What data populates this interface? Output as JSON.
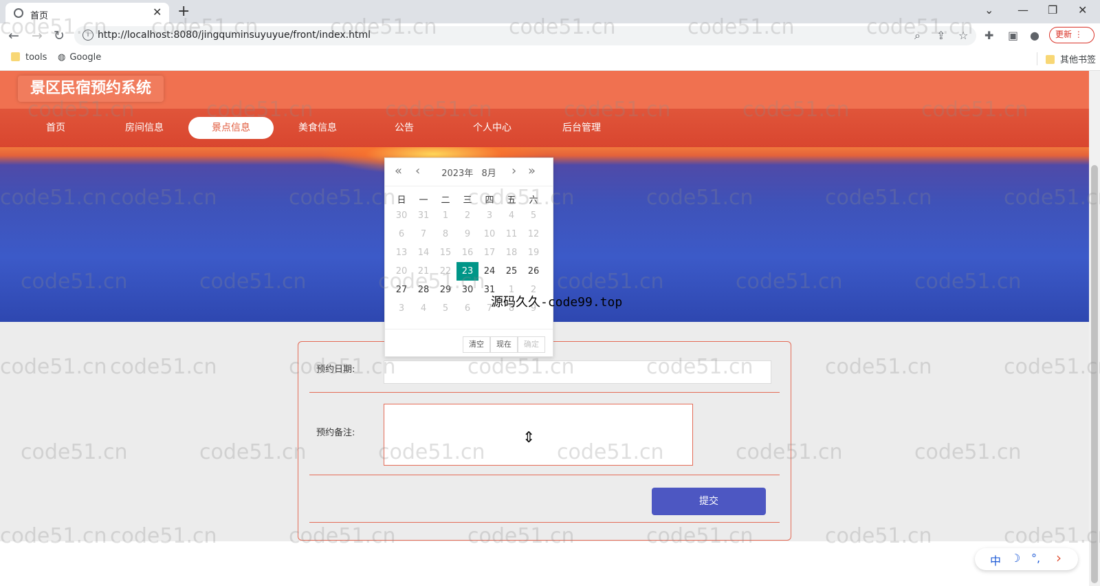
{
  "browser": {
    "tab_title": "首页",
    "url": "http://localhost:8080/jingquminsuyuyue/front/index.html",
    "update_label": "更新",
    "bookmarks": [
      "tools",
      "Google"
    ],
    "other_bookmarks": "其他书签"
  },
  "site": {
    "title": "景区民宿预约系统",
    "nav": [
      "首页",
      "房间信息",
      "景点信息",
      "美食信息",
      "公告",
      "个人中心",
      "后台管理"
    ],
    "active_nav": "景点信息"
  },
  "form": {
    "date_label": "预约日期:",
    "date_value": "",
    "remark_label": "预约备注:",
    "remark_value": "",
    "submit_label": "提交"
  },
  "datepicker": {
    "year_label": "2023年",
    "month_label": "8月",
    "weekdays": [
      "日",
      "一",
      "二",
      "三",
      "四",
      "五",
      "六"
    ],
    "weeks": [
      [
        "30",
        "31",
        "1",
        "2",
        "3",
        "4",
        "5"
      ],
      [
        "6",
        "7",
        "8",
        "9",
        "10",
        "11",
        "12"
      ],
      [
        "13",
        "14",
        "15",
        "16",
        "17",
        "18",
        "19"
      ],
      [
        "20",
        "21",
        "22",
        "23",
        "24",
        "25",
        "26"
      ],
      [
        "27",
        "28",
        "29",
        "30",
        "31",
        "1",
        "2"
      ],
      [
        "3",
        "4",
        "5",
        "6",
        "7",
        "8",
        "9"
      ]
    ],
    "selected_day": "23",
    "buttons": {
      "clear": "清空",
      "now": "现在",
      "confirm": "确定"
    }
  },
  "overlay_text": "源码久久-code99.top",
  "watermark": "code51.cn",
  "ime": {
    "lang": "中",
    "moon": "☽",
    "punct": "°,",
    "arrow": "›"
  },
  "colors": {
    "header": "#f07150",
    "nav": "#d9462f",
    "form_border": "#e46a55",
    "submit": "#4d57c2",
    "selected_day": "#009688"
  }
}
